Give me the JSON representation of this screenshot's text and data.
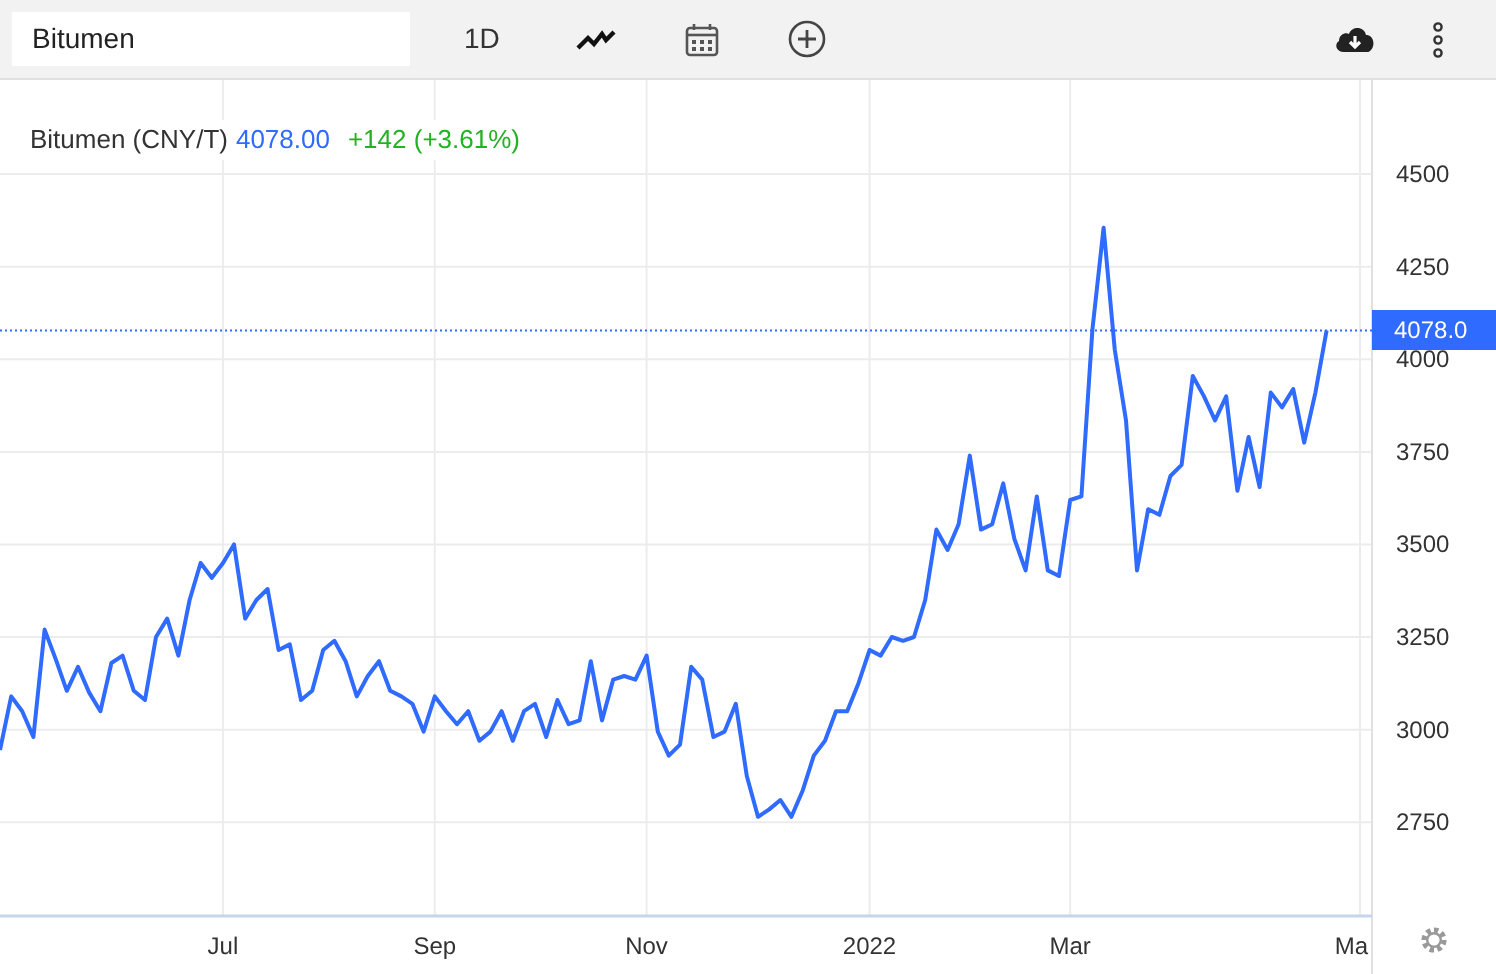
{
  "toolbar": {
    "search_value": "Bitumen",
    "interval": "1D"
  },
  "legend": {
    "name": "Bitumen (CNY/T)",
    "price": "4078.00",
    "change": "+142 (+3.61%)"
  },
  "chart_data": {
    "type": "line",
    "grid": true,
    "ylim": [
      2497,
      4754
    ],
    "ref_lines": [
      {
        "axis": "y",
        "value": 4078,
        "label": "4078.0"
      }
    ],
    "categories": [
      null,
      null,
      null,
      null,
      null,
      null,
      null,
      null,
      null,
      null,
      null,
      null,
      null,
      null,
      null,
      null,
      null,
      null,
      null,
      null,
      "Jul",
      null,
      null,
      null,
      null,
      null,
      null,
      null,
      null,
      null,
      null,
      null,
      null,
      null,
      null,
      null,
      null,
      null,
      null,
      "Sep",
      null,
      null,
      null,
      null,
      null,
      null,
      null,
      null,
      null,
      null,
      null,
      null,
      null,
      null,
      null,
      null,
      null,
      null,
      "Nov",
      null,
      null,
      null,
      null,
      null,
      null,
      null,
      null,
      null,
      null,
      null,
      null,
      null,
      null,
      null,
      null,
      null,
      null,
      null,
      "2022",
      null,
      null,
      null,
      null,
      null,
      null,
      null,
      null,
      null,
      null,
      null,
      null,
      null,
      null,
      null,
      null,
      null,
      "Mar",
      null,
      null,
      null,
      null,
      null,
      null,
      null,
      null,
      null,
      null,
      null,
      null,
      null,
      null,
      null,
      null,
      null,
      null,
      null,
      null,
      null,
      null,
      null,
      null,
      null,
      "Ma"
    ],
    "yticks": [
      2750,
      3000,
      3250,
      3500,
      3750,
      4000,
      4250,
      4500
    ],
    "series": [
      {
        "color": "#2f6bff",
        "values": [
          2945,
          3090,
          3050,
          2980,
          3270,
          3190,
          3105,
          3170,
          3100,
          3050,
          3180,
          3200,
          3105,
          3080,
          3250,
          3300,
          3200,
          3350,
          3450,
          3410,
          3450,
          3500,
          3300,
          3350,
          3380,
          3215,
          3230,
          3080,
          3105,
          3215,
          3240,
          3185,
          3090,
          3145,
          3185,
          3105,
          3090,
          3070,
          2995,
          3090,
          3050,
          3015,
          3050,
          2970,
          2995,
          3050,
          2970,
          3050,
          3070,
          2980,
          3080,
          3015,
          3025,
          3185,
          3025,
          3135,
          3145,
          3135,
          3200,
          2995,
          2930,
          2960,
          3170,
          3135,
          2980,
          2995,
          3070,
          2875,
          2765,
          2785,
          2810,
          2765,
          2835,
          2930,
          2970,
          3050,
          3050,
          3125,
          3215,
          3200,
          3250,
          3240,
          3250,
          3350,
          3540,
          3485,
          3555,
          3740,
          3540,
          3555,
          3665,
          3515,
          3430,
          3630,
          3430,
          3415,
          3620,
          3630,
          4080,
          4355,
          4025,
          3835,
          3430,
          3595,
          3580,
          3685,
          3715,
          3955,
          3900,
          3835,
          3900,
          3645,
          3790,
          3655,
          3910,
          3870,
          3920,
          3775,
          3910,
          4078,
          null,
          null,
          null
        ]
      }
    ]
  }
}
